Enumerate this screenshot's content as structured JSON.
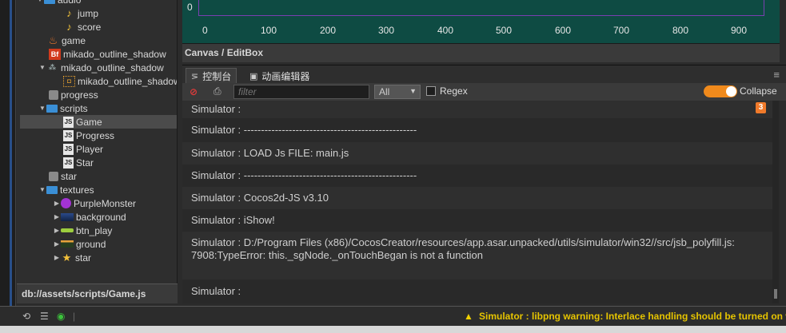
{
  "assets": {
    "items": [
      {
        "label": "audio",
        "type": "folder",
        "depth": 1,
        "expanded": true
      },
      {
        "label": "jump",
        "type": "audio",
        "depth": 2
      },
      {
        "label": "score",
        "type": "audio",
        "depth": 2
      },
      {
        "label": "game",
        "type": "scene",
        "depth": 1
      },
      {
        "label": "mikado_outline_shadow",
        "type": "bitmap-font",
        "depth": 1
      },
      {
        "label": "mikado_outline_shadow",
        "type": "atlas",
        "depth": 1,
        "expanded": true
      },
      {
        "label": "mikado_outline_shadow",
        "type": "sprite-frame",
        "depth": 2
      },
      {
        "label": "progress",
        "type": "prefab",
        "depth": 1
      },
      {
        "label": "scripts",
        "type": "folder",
        "depth": 1,
        "expanded": true
      },
      {
        "label": "Game",
        "type": "js",
        "depth": 2,
        "selected": true
      },
      {
        "label": "Progress",
        "type": "js",
        "depth": 2
      },
      {
        "label": "Player",
        "type": "js",
        "depth": 2
      },
      {
        "label": "Star",
        "type": "js",
        "depth": 2
      },
      {
        "label": "star",
        "type": "prefab",
        "depth": 1
      },
      {
        "label": "textures",
        "type": "folder",
        "depth": 1,
        "expanded": true
      },
      {
        "label": "PurpleMonster",
        "type": "texture-purple",
        "depth": 2,
        "collapsed": true
      },
      {
        "label": "background",
        "type": "texture-bg",
        "depth": 2,
        "collapsed": true
      },
      {
        "label": "btn_play",
        "type": "texture-btn",
        "depth": 2,
        "collapsed": true
      },
      {
        "label": "ground",
        "type": "texture-ground",
        "depth": 2,
        "collapsed": true
      },
      {
        "label": "star",
        "type": "texture-star",
        "depth": 2,
        "collapsed": true
      }
    ],
    "footer_path": "db://assets/scripts/Game.js"
  },
  "canvas": {
    "y_label": "0",
    "x_ticks": [
      "0",
      "100",
      "200",
      "300",
      "400",
      "500",
      "600",
      "700",
      "800",
      "900"
    ],
    "title": "Canvas / EditBox"
  },
  "console": {
    "tabs": [
      {
        "label": "控制台",
        "icon": "console-icon",
        "active": true
      },
      {
        "label": "动画编辑器",
        "icon": "animation-icon",
        "active": false
      }
    ],
    "filter_placeholder": "filter",
    "level": "All",
    "regex_label": "Regex",
    "collapse_label": "Collapse",
    "collapse_on": true,
    "badge_count": "3",
    "logs": [
      "Simulator :",
      "Simulator : --------------------------------------------------",
      "Simulator : LOAD Js FILE: main.js",
      "Simulator : --------------------------------------------------",
      "Simulator : Cocos2d-JS v3.10",
      "Simulator : iShow!",
      "Simulator : D:/Program Files (x86)/CocosCreator/resources/app.asar.unpacked/utils/simulator/win32//src/jsb_polyfill.js:7908:TypeError: this._sgNode._onTouchBegan is not a function",
      "Simulator :"
    ]
  },
  "statusbar": {
    "message": "Simulator : libpng warning: Interlace handling should be turned on when using png_read_image"
  },
  "colors": {
    "accent_orange": "#f08a1c",
    "canvas_bg": "#0e4b43",
    "warning_yellow": "#e6c400"
  }
}
